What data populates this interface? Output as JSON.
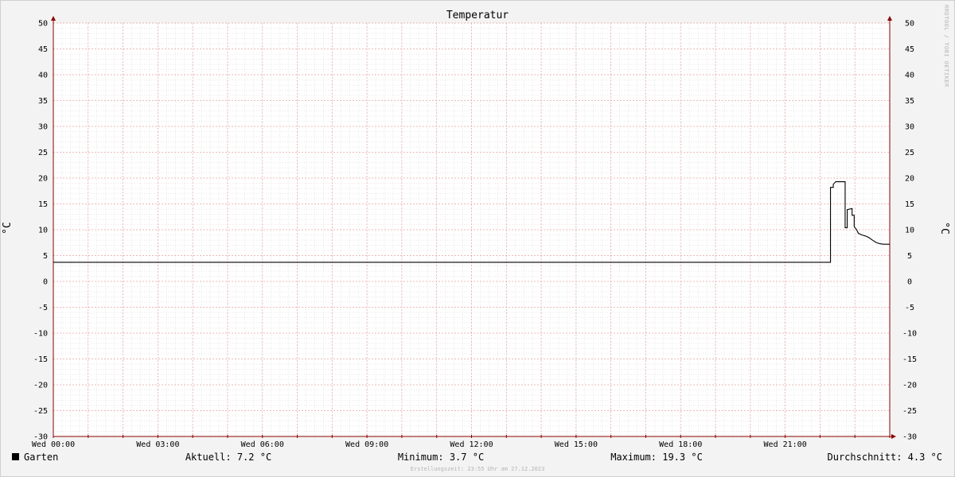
{
  "chart_data": {
    "type": "line",
    "title": "Temperatur",
    "ylabel": "°C",
    "ylabel_right": "°C",
    "ylim": [
      -30,
      50
    ],
    "yticks": [
      50,
      45,
      40,
      35,
      30,
      25,
      20,
      15,
      10,
      5,
      0,
      -5,
      -10,
      -15,
      -20,
      -25,
      -30
    ],
    "xlim": [
      0,
      24
    ],
    "xticks": [
      {
        "x": 0,
        "label": "Wed 00:00"
      },
      {
        "x": 3,
        "label": "Wed 03:00"
      },
      {
        "x": 6,
        "label": "Wed 06:00"
      },
      {
        "x": 9,
        "label": "Wed 09:00"
      },
      {
        "x": 12,
        "label": "Wed 12:00"
      },
      {
        "x": 15,
        "label": "Wed 15:00"
      },
      {
        "x": 18,
        "label": "Wed 18:00"
      },
      {
        "x": 21,
        "label": "Wed 21:00"
      }
    ],
    "grid": true,
    "series": [
      {
        "name": "Garten",
        "color": "#000000",
        "points": [
          [
            0,
            3.7
          ],
          [
            22.3,
            3.7
          ],
          [
            22.3,
            18.2
          ],
          [
            22.38,
            18.2
          ],
          [
            22.38,
            18.8
          ],
          [
            22.45,
            19.3
          ],
          [
            22.72,
            19.3
          ],
          [
            22.72,
            10.4
          ],
          [
            22.78,
            10.4
          ],
          [
            22.78,
            13.9
          ],
          [
            22.92,
            14.1
          ],
          [
            22.92,
            12.8
          ],
          [
            22.98,
            12.8
          ],
          [
            22.98,
            10.6
          ],
          [
            23.05,
            10.0
          ],
          [
            23.1,
            9.3
          ],
          [
            23.2,
            9.0
          ],
          [
            23.3,
            8.8
          ],
          [
            23.4,
            8.5
          ],
          [
            23.48,
            8.1
          ],
          [
            23.55,
            7.8
          ],
          [
            23.62,
            7.5
          ],
          [
            23.72,
            7.3
          ],
          [
            23.82,
            7.2
          ],
          [
            24,
            7.2
          ]
        ]
      }
    ],
    "stats": {
      "aktuell": "Aktuell: 7.2 °C",
      "minimum": "Minimum: 3.7 °C",
      "maximum": "Maximum: 19.3 °C",
      "durchschnitt": "Durchschnitt: 4.3 °C"
    },
    "footer": "Erstellungszeit: 23:55 Uhr am 27.12.2023",
    "watermark": "RRDTOOL / TOBI OETIKER"
  },
  "colors": {
    "background": "#f3f3f3",
    "plot_background": "#ffffff",
    "major_grid": "#e6a3a3",
    "minor_grid": "#d0d0d0",
    "axis": "#8b0000",
    "series": "#000000"
  }
}
